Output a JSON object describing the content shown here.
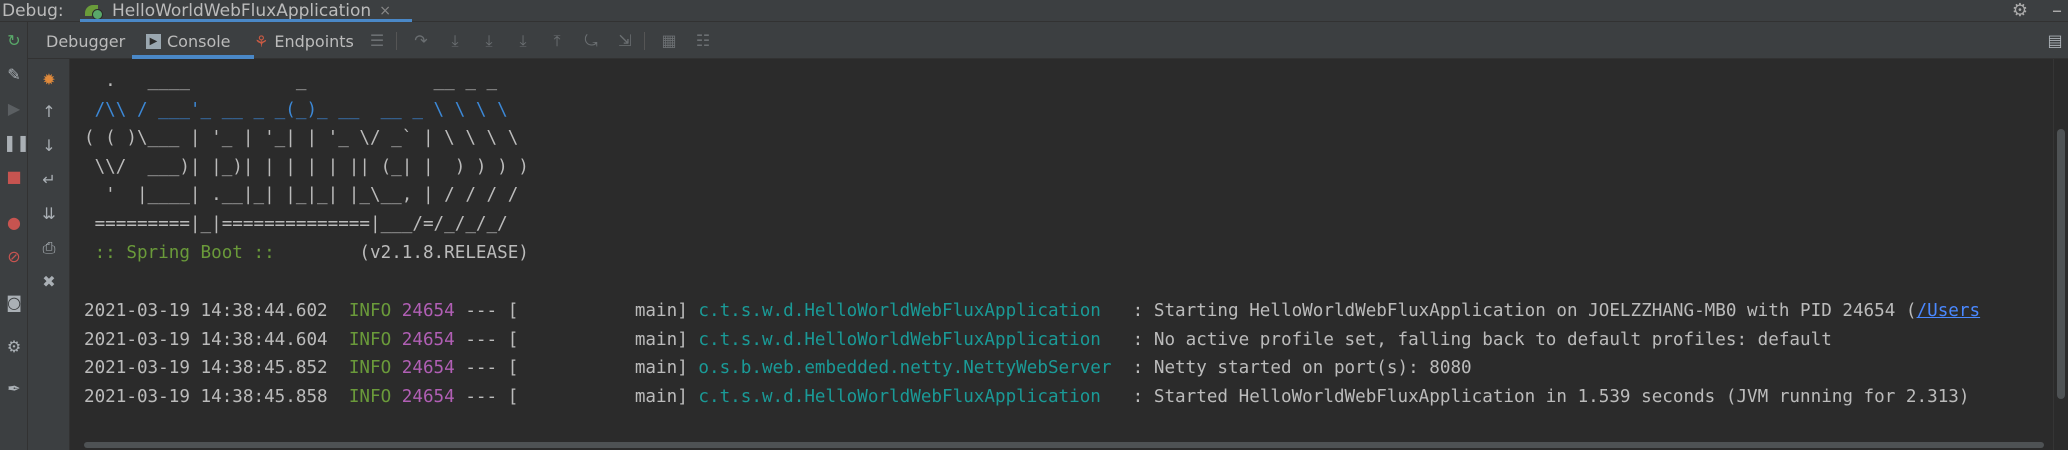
{
  "topbar": {
    "label": "Debug:",
    "tab_label": "HelloWorldWebFluxApplication",
    "tab_close": "×"
  },
  "toolbar": {
    "tabs": {
      "debugger": "Debugger",
      "console": "Console",
      "endpoints": "Endpoints"
    }
  },
  "banner": [
    "  .   ____          _            __ _ _",
    " /\\\\ / ___'_ __ _ _(_)_ __  __ _ \\ \\ \\ \\",
    "( ( )\\___ | '_ | '_| | '_ \\/ _` | \\ \\ \\ \\",
    " \\\\/  ___)| |_)| | | | | || (_| |  ) ) ) )",
    "  '  |____| .__|_| |_|_| |_\\__, | / / / /",
    " =========|_|==============|___/=/_/_/_/"
  ],
  "spring": {
    "label": " :: Spring Boot :: ",
    "version": "       (v2.1.8.RELEASE)"
  },
  "logs": [
    {
      "ts": "2021-03-19 14:38:44.602",
      "level": "INFO",
      "pid": "24654",
      "sep": " --- [",
      "thread": "           main]",
      "logger": "c.t.s.w.d.HelloWorldWebFluxApplication  ",
      "msg": " : Starting HelloWorldWebFluxApplication on JOELZZHANG-MB0 with PID 24654 (",
      "link": "/Users"
    },
    {
      "ts": "2021-03-19 14:38:44.604",
      "level": "INFO",
      "pid": "24654",
      "sep": " --- [",
      "thread": "           main]",
      "logger": "c.t.s.w.d.HelloWorldWebFluxApplication  ",
      "msg": " : No active profile set, falling back to default profiles: default",
      "link": ""
    },
    {
      "ts": "2021-03-19 14:38:45.852",
      "level": "INFO",
      "pid": "24654",
      "sep": " --- [",
      "thread": "           main]",
      "logger": "o.s.b.web.embedded.netty.NettyWebServer ",
      "msg": " : Netty started on port(s): 8080",
      "link": ""
    },
    {
      "ts": "2021-03-19 14:38:45.858",
      "level": "INFO",
      "pid": "24654",
      "sep": " --- [",
      "thread": "           main]",
      "logger": "c.t.s.w.d.HelloWorldWebFluxApplication  ",
      "msg": " : Started HelloWorldWebFluxApplication in 1.539 seconds (JVM running for 2.313)",
      "link": ""
    }
  ],
  "colors": {
    "accent": "#4a88c7",
    "level": "#6a9a3a",
    "pid": "#b15fb5",
    "logger": "#1a9a97",
    "link": "#4a88ff"
  },
  "icons": {
    "left_bar": [
      "rerun-icon",
      "wrench-icon",
      "resume-icon",
      "pause-icon",
      "stop-icon",
      "view-breakpoints-icon",
      "mute-breakpoints-icon",
      "camera-icon",
      "settings-icon",
      "pin-icon"
    ],
    "console_bar": [
      "fire-icon",
      "up-arrow-icon",
      "down-arrow-icon",
      "soft-wrap-icon",
      "scroll-to-end-icon",
      "print-icon",
      "trash-icon"
    ]
  }
}
